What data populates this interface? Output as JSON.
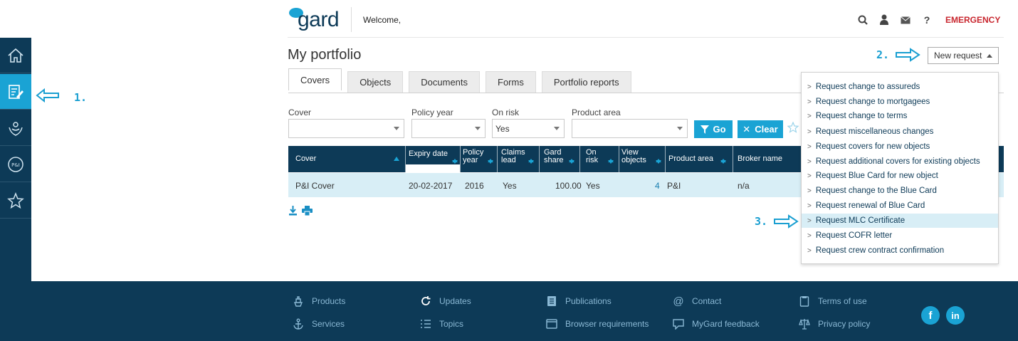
{
  "header": {
    "logo_text": "gard",
    "welcome": "Welcome,",
    "icons": [
      "search-icon",
      "user-icon",
      "mail-icon",
      "help-icon"
    ],
    "help_label": "?",
    "emergency": "EMERGENCY"
  },
  "sidebar": {
    "items": [
      "home-icon",
      "portfolio-edit-icon",
      "people-care-icon",
      "pi-icon",
      "star-icon"
    ],
    "pi_label": "P&I",
    "active_index": 1
  },
  "annotations": [
    "1.",
    "2.",
    "3."
  ],
  "page": {
    "title": "My portfolio",
    "tabs": [
      "Covers",
      "Objects",
      "Documents",
      "Forms",
      "Portfolio reports"
    ],
    "active_tab": "Covers"
  },
  "filters": {
    "cover_label": "Cover",
    "policy_year_label": "Policy year",
    "on_risk_label": "On risk",
    "on_risk_value": "Yes",
    "product_area_label": "Product area",
    "go_label": "Go",
    "clear_label": "Clear"
  },
  "table": {
    "headers": [
      "Cover",
      "Expiry date",
      "Policy year",
      "Claims lead",
      "Gard share",
      "On risk",
      "View objects",
      "Product area",
      "Broker name"
    ],
    "rows": [
      {
        "cover": "P&I Cover",
        "expiry": "20-02-2017",
        "policy_year": "2016",
        "claims_lead": "Yes",
        "gard_share": "100.00",
        "on_risk": "Yes",
        "view_objects": "4",
        "product_area": "P&I",
        "broker": "n/a"
      }
    ]
  },
  "new_request": {
    "label": "New request",
    "items": [
      "Request change to assureds",
      "Request change to mortgagees",
      "Request change to terms",
      "Request miscellaneous changes",
      "Request covers for new objects",
      "Request additional covers for existing objects",
      "Request Blue Card for new object",
      "Request change to the Blue Card",
      "Request renewal of Blue Card",
      "Request MLC Certificate",
      "Request COFR letter",
      "Request crew contract confirmation"
    ],
    "highlighted_index": 9
  },
  "footer": {
    "links": [
      "Products",
      "Updates",
      "Publications",
      "Contact",
      "Terms of use",
      "Services",
      "Topics",
      "Browser requirements",
      "MyGard feedback",
      "Privacy policy"
    ],
    "social": [
      "f",
      "in"
    ]
  },
  "colors": {
    "navy": "#0d3a57",
    "accent": "#1aa3d4",
    "emergency": "#c8262e",
    "row": "#d8eef6"
  }
}
